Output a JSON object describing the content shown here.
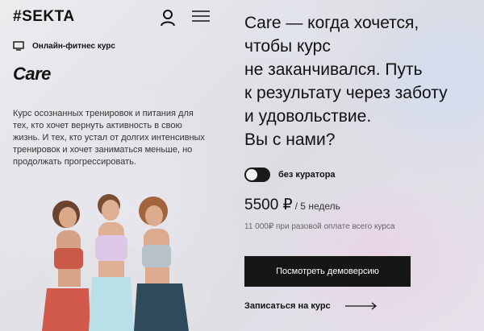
{
  "header": {
    "logo_text": "#SEKTA",
    "user_icon": "user-icon",
    "menu_icon": "hamburger-menu-icon"
  },
  "course": {
    "type_icon": "monitor-icon",
    "type_label": "Онлайн-фитнес курс",
    "brand": "Care",
    "description": "Курс осознанных тренировок и питания для тех, кто хочет вернуть активность в свою жизнь. И тех, кто устал от долгих интенсивных тренировок и хочет заниматься меньше, но продолжать прогрессировать."
  },
  "hero": {
    "headline_lines": [
      "Care — когда хочется,",
      "чтобы курс",
      "не заканчивался. Путь",
      "к результату через заботу",
      "и удовольствие.",
      "Вы с нами?"
    ]
  },
  "offer": {
    "toggle_label": "без куратора",
    "toggle_on": false,
    "price": "5500 ₽",
    "period": "/ 5 недель",
    "note": "11 000₽ при разовой оплате всего курса",
    "demo_button": "Посмотреть демоверсию",
    "signup_link": "Записаться на курс",
    "signup_icon": "arrow-right-icon"
  },
  "colors": {
    "dark": "#161616",
    "muted": "#666666"
  }
}
